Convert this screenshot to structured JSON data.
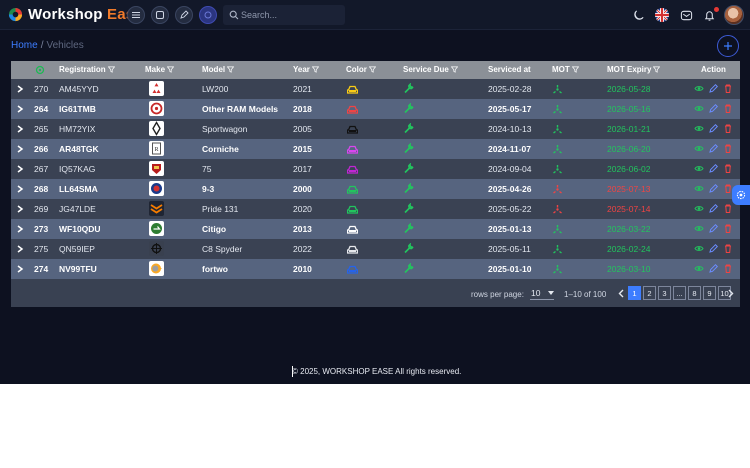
{
  "app": {
    "brand_main": "Workshop ",
    "brand_accent": "Ease"
  },
  "search": {
    "placeholder": "Search..."
  },
  "breadcrumb": {
    "home": "Home",
    "separator": "/",
    "current": "Vehicles"
  },
  "colors": {
    "accent": "#3d7dff",
    "brand_orange": "#f07a2a",
    "ok_green": "#22c55e",
    "expired_red": "#ef4444",
    "header_bg": "#8b9097"
  },
  "table": {
    "headers": {
      "registration": "Registration",
      "make": "Make",
      "model": "Model",
      "year": "Year",
      "color": "Color",
      "service_due": "Service Due",
      "serviced_at": "Serviced at",
      "mot": "MOT",
      "mot_expiry": "MOT Expiry",
      "action": "Action"
    },
    "rows": [
      {
        "id": "270",
        "registration": "AM45YYD",
        "make_icon": "mitsubishi-logo",
        "model": "LW200",
        "year": "2021",
        "car_color": "#facc15",
        "serviced_at": "2025-02-28",
        "mot_status": "pass",
        "mot_expiry": "2026-05-28"
      },
      {
        "id": "264",
        "registration": "IG61TMB",
        "make_icon": "ram-logo",
        "model": "Other RAM Models",
        "year": "2018",
        "car_color": "#ef4444",
        "serviced_at": "2025-05-17",
        "mot_status": "pass",
        "mot_expiry": "2026-05-16"
      },
      {
        "id": "265",
        "registration": "HM72YIX",
        "make_icon": "renault-logo",
        "model": "Sportwagon",
        "year": "2005",
        "car_color": "#111111",
        "serviced_at": "2024-10-13",
        "mot_status": "pass",
        "mot_expiry": "2026-01-21"
      },
      {
        "id": "266",
        "registration": "AR48TGK",
        "make_icon": "rolls-royce-logo",
        "model": "Corniche",
        "year": "2015",
        "car_color": "#d946ef",
        "serviced_at": "2024-11-07",
        "mot_status": "pass",
        "mot_expiry": "2026-06-20"
      },
      {
        "id": "267",
        "registration": "IQ57KAG",
        "make_icon": "rover-logo",
        "model": "75",
        "year": "2017",
        "car_color": "#c026d3",
        "serviced_at": "2024-09-04",
        "mot_status": "pass",
        "mot_expiry": "2026-06-02"
      },
      {
        "id": "268",
        "registration": "LL64SMA",
        "make_icon": "saab-logo",
        "model": "9-3",
        "year": "2000",
        "car_color": "#22c55e",
        "serviced_at": "2025-04-26",
        "mot_status": "fail",
        "mot_expiry": "2025-07-13"
      },
      {
        "id": "269",
        "registration": "JG47LDE",
        "make_icon": "saipa-logo",
        "model": "Pride 131",
        "year": "2020",
        "car_color": "#22c55e",
        "serviced_at": "2025-05-22",
        "mot_status": "fail",
        "mot_expiry": "2025-07-14"
      },
      {
        "id": "273",
        "registration": "WF10QDU",
        "make_icon": "skoda-logo",
        "model": "Citigo",
        "year": "2013",
        "car_color": "#ffffff",
        "serviced_at": "2025-01-13",
        "mot_status": "pass",
        "mot_expiry": "2026-03-22"
      },
      {
        "id": "275",
        "registration": "QN59IEP",
        "make_icon": "spyker-logo",
        "model": "C8 Spyder",
        "year": "2022",
        "car_color": "#e5e7eb",
        "serviced_at": "2025-05-11",
        "mot_status": "pass",
        "mot_expiry": "2026-02-24"
      },
      {
        "id": "274",
        "registration": "NV99TFU",
        "make_icon": "smart-logo",
        "model": "fortwo",
        "year": "2010",
        "car_color": "#2563eb",
        "serviced_at": "2025-01-10",
        "mot_status": "pass",
        "mot_expiry": "2026-03-10"
      }
    ]
  },
  "pagination": {
    "rows_per_page_label": "rows per page:",
    "rows_per_page_value": "10",
    "range_text": "1–10 of 100",
    "pages": [
      "1",
      "2",
      "3",
      "...",
      "8",
      "9",
      "10"
    ],
    "active_page": "1"
  },
  "footer": {
    "copyright": "© 2025, WORKSHOP EASE All rights reserved."
  }
}
